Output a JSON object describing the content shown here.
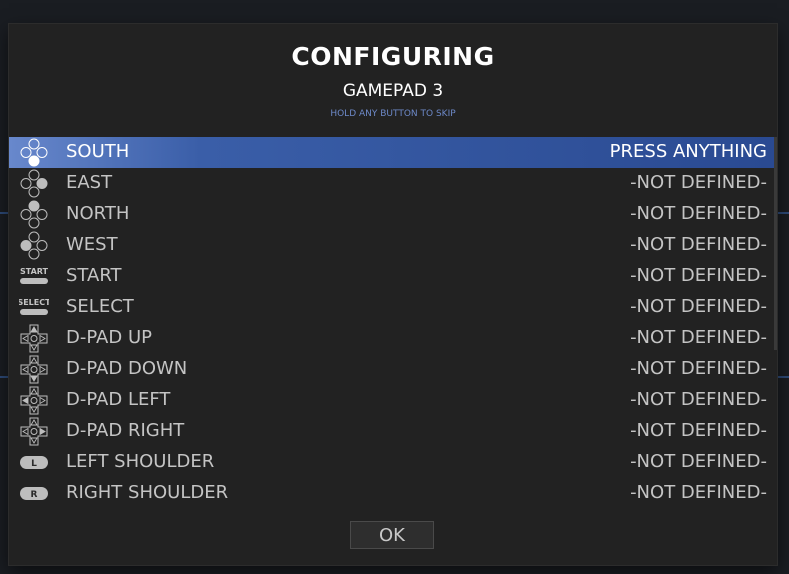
{
  "dialog": {
    "title": "CONFIGURING",
    "subtitle": "GAMEPAD 3",
    "hint": "HOLD ANY BUTTON TO SKIP",
    "ok_label": "OK"
  },
  "rows": [
    {
      "label": "SOUTH",
      "value": "PRESS ANYTHING",
      "icon": "face-button-south-icon",
      "selected": true
    },
    {
      "label": "EAST",
      "value": "-NOT DEFINED-",
      "icon": "face-button-east-icon"
    },
    {
      "label": "NORTH",
      "value": "-NOT DEFINED-",
      "icon": "face-button-north-icon"
    },
    {
      "label": "WEST",
      "value": "-NOT DEFINED-",
      "icon": "face-button-west-icon"
    },
    {
      "label": "START",
      "value": "-NOT DEFINED-",
      "icon": "start-button-icon",
      "badge": "START"
    },
    {
      "label": "SELECT",
      "value": "-NOT DEFINED-",
      "icon": "select-button-icon",
      "badge": "SELECT"
    },
    {
      "label": "D-PAD UP",
      "value": "-NOT DEFINED-",
      "icon": "dpad-up-icon"
    },
    {
      "label": "D-PAD DOWN",
      "value": "-NOT DEFINED-",
      "icon": "dpad-down-icon"
    },
    {
      "label": "D-PAD LEFT",
      "value": "-NOT DEFINED-",
      "icon": "dpad-left-icon"
    },
    {
      "label": "D-PAD RIGHT",
      "value": "-NOT DEFINED-",
      "icon": "dpad-right-icon"
    },
    {
      "label": "LEFT SHOULDER",
      "value": "-NOT DEFINED-",
      "icon": "left-shoulder-icon",
      "badge": "L"
    },
    {
      "label": "RIGHT SHOULDER",
      "value": "-NOT DEFINED-",
      "icon": "right-shoulder-icon",
      "badge": "R"
    }
  ],
  "colors": {
    "selected_start": "#6888cc",
    "selected_end": "#2a4a92",
    "hint": "#6d89c8",
    "text": "#c4c4c4"
  }
}
